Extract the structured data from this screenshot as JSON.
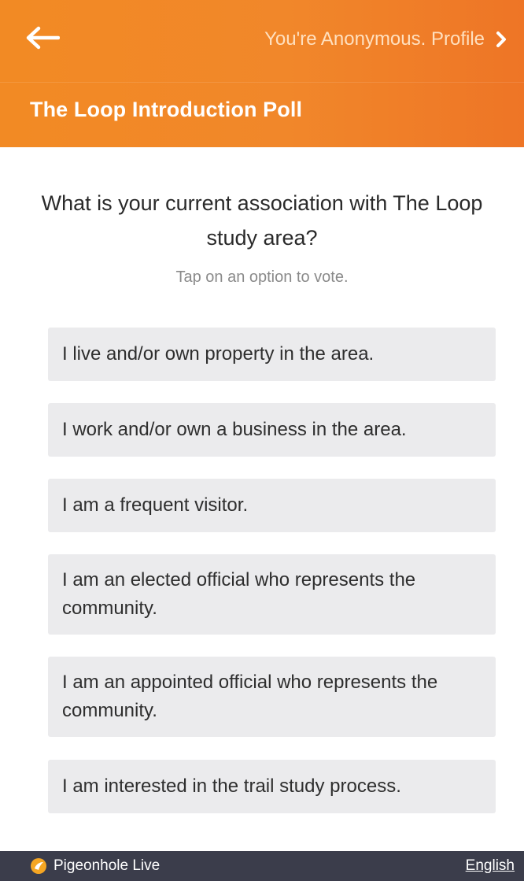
{
  "header": {
    "profile_label": "You're Anonymous. Profile",
    "poll_title": "The Loop Introduction Poll",
    "accent_color": "#f28a24"
  },
  "question": {
    "text": "What is your current association with The Loop study area?",
    "hint": "Tap on an option to vote."
  },
  "options": [
    {
      "label": "I live and/or own property in the area."
    },
    {
      "label": "I work and/or own a business in the area."
    },
    {
      "label": "I am a frequent visitor."
    },
    {
      "label": "I am an elected official who represents the community."
    },
    {
      "label": "I am an appointed official who represents the community."
    },
    {
      "label": "I am interested in the trail study process."
    }
  ],
  "footer": {
    "brand": "Pigeonhole Live",
    "language": "English",
    "background_color": "#3b3d4b"
  },
  "icons": {
    "back": "arrow-left-icon",
    "profile_chevron": "chevron-right-icon",
    "brand_logo": "pigeonhole-logo-icon"
  }
}
